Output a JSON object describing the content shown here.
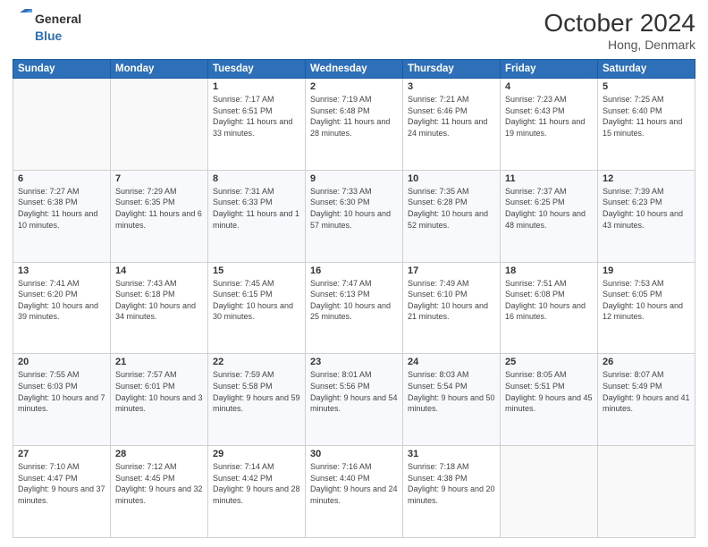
{
  "header": {
    "logo_line1": "General",
    "logo_line2": "Blue",
    "month": "October 2024",
    "location": "Hong, Denmark"
  },
  "weekdays": [
    "Sunday",
    "Monday",
    "Tuesday",
    "Wednesday",
    "Thursday",
    "Friday",
    "Saturday"
  ],
  "weeks": [
    [
      {
        "day": "",
        "sunrise": "",
        "sunset": "",
        "daylight": ""
      },
      {
        "day": "",
        "sunrise": "",
        "sunset": "",
        "daylight": ""
      },
      {
        "day": "1",
        "sunrise": "Sunrise: 7:17 AM",
        "sunset": "Sunset: 6:51 PM",
        "daylight": "Daylight: 11 hours and 33 minutes."
      },
      {
        "day": "2",
        "sunrise": "Sunrise: 7:19 AM",
        "sunset": "Sunset: 6:48 PM",
        "daylight": "Daylight: 11 hours and 28 minutes."
      },
      {
        "day": "3",
        "sunrise": "Sunrise: 7:21 AM",
        "sunset": "Sunset: 6:46 PM",
        "daylight": "Daylight: 11 hours and 24 minutes."
      },
      {
        "day": "4",
        "sunrise": "Sunrise: 7:23 AM",
        "sunset": "Sunset: 6:43 PM",
        "daylight": "Daylight: 11 hours and 19 minutes."
      },
      {
        "day": "5",
        "sunrise": "Sunrise: 7:25 AM",
        "sunset": "Sunset: 6:40 PM",
        "daylight": "Daylight: 11 hours and 15 minutes."
      }
    ],
    [
      {
        "day": "6",
        "sunrise": "Sunrise: 7:27 AM",
        "sunset": "Sunset: 6:38 PM",
        "daylight": "Daylight: 11 hours and 10 minutes."
      },
      {
        "day": "7",
        "sunrise": "Sunrise: 7:29 AM",
        "sunset": "Sunset: 6:35 PM",
        "daylight": "Daylight: 11 hours and 6 minutes."
      },
      {
        "day": "8",
        "sunrise": "Sunrise: 7:31 AM",
        "sunset": "Sunset: 6:33 PM",
        "daylight": "Daylight: 11 hours and 1 minute."
      },
      {
        "day": "9",
        "sunrise": "Sunrise: 7:33 AM",
        "sunset": "Sunset: 6:30 PM",
        "daylight": "Daylight: 10 hours and 57 minutes."
      },
      {
        "day": "10",
        "sunrise": "Sunrise: 7:35 AM",
        "sunset": "Sunset: 6:28 PM",
        "daylight": "Daylight: 10 hours and 52 minutes."
      },
      {
        "day": "11",
        "sunrise": "Sunrise: 7:37 AM",
        "sunset": "Sunset: 6:25 PM",
        "daylight": "Daylight: 10 hours and 48 minutes."
      },
      {
        "day": "12",
        "sunrise": "Sunrise: 7:39 AM",
        "sunset": "Sunset: 6:23 PM",
        "daylight": "Daylight: 10 hours and 43 minutes."
      }
    ],
    [
      {
        "day": "13",
        "sunrise": "Sunrise: 7:41 AM",
        "sunset": "Sunset: 6:20 PM",
        "daylight": "Daylight: 10 hours and 39 minutes."
      },
      {
        "day": "14",
        "sunrise": "Sunrise: 7:43 AM",
        "sunset": "Sunset: 6:18 PM",
        "daylight": "Daylight: 10 hours and 34 minutes."
      },
      {
        "day": "15",
        "sunrise": "Sunrise: 7:45 AM",
        "sunset": "Sunset: 6:15 PM",
        "daylight": "Daylight: 10 hours and 30 minutes."
      },
      {
        "day": "16",
        "sunrise": "Sunrise: 7:47 AM",
        "sunset": "Sunset: 6:13 PM",
        "daylight": "Daylight: 10 hours and 25 minutes."
      },
      {
        "day": "17",
        "sunrise": "Sunrise: 7:49 AM",
        "sunset": "Sunset: 6:10 PM",
        "daylight": "Daylight: 10 hours and 21 minutes."
      },
      {
        "day": "18",
        "sunrise": "Sunrise: 7:51 AM",
        "sunset": "Sunset: 6:08 PM",
        "daylight": "Daylight: 10 hours and 16 minutes."
      },
      {
        "day": "19",
        "sunrise": "Sunrise: 7:53 AM",
        "sunset": "Sunset: 6:05 PM",
        "daylight": "Daylight: 10 hours and 12 minutes."
      }
    ],
    [
      {
        "day": "20",
        "sunrise": "Sunrise: 7:55 AM",
        "sunset": "Sunset: 6:03 PM",
        "daylight": "Daylight: 10 hours and 7 minutes."
      },
      {
        "day": "21",
        "sunrise": "Sunrise: 7:57 AM",
        "sunset": "Sunset: 6:01 PM",
        "daylight": "Daylight: 10 hours and 3 minutes."
      },
      {
        "day": "22",
        "sunrise": "Sunrise: 7:59 AM",
        "sunset": "Sunset: 5:58 PM",
        "daylight": "Daylight: 9 hours and 59 minutes."
      },
      {
        "day": "23",
        "sunrise": "Sunrise: 8:01 AM",
        "sunset": "Sunset: 5:56 PM",
        "daylight": "Daylight: 9 hours and 54 minutes."
      },
      {
        "day": "24",
        "sunrise": "Sunrise: 8:03 AM",
        "sunset": "Sunset: 5:54 PM",
        "daylight": "Daylight: 9 hours and 50 minutes."
      },
      {
        "day": "25",
        "sunrise": "Sunrise: 8:05 AM",
        "sunset": "Sunset: 5:51 PM",
        "daylight": "Daylight: 9 hours and 45 minutes."
      },
      {
        "day": "26",
        "sunrise": "Sunrise: 8:07 AM",
        "sunset": "Sunset: 5:49 PM",
        "daylight": "Daylight: 9 hours and 41 minutes."
      }
    ],
    [
      {
        "day": "27",
        "sunrise": "Sunrise: 7:10 AM",
        "sunset": "Sunset: 4:47 PM",
        "daylight": "Daylight: 9 hours and 37 minutes."
      },
      {
        "day": "28",
        "sunrise": "Sunrise: 7:12 AM",
        "sunset": "Sunset: 4:45 PM",
        "daylight": "Daylight: 9 hours and 32 minutes."
      },
      {
        "day": "29",
        "sunrise": "Sunrise: 7:14 AM",
        "sunset": "Sunset: 4:42 PM",
        "daylight": "Daylight: 9 hours and 28 minutes."
      },
      {
        "day": "30",
        "sunrise": "Sunrise: 7:16 AM",
        "sunset": "Sunset: 4:40 PM",
        "daylight": "Daylight: 9 hours and 24 minutes."
      },
      {
        "day": "31",
        "sunrise": "Sunrise: 7:18 AM",
        "sunset": "Sunset: 4:38 PM",
        "daylight": "Daylight: 9 hours and 20 minutes."
      },
      {
        "day": "",
        "sunrise": "",
        "sunset": "",
        "daylight": ""
      },
      {
        "day": "",
        "sunrise": "",
        "sunset": "",
        "daylight": ""
      }
    ]
  ]
}
